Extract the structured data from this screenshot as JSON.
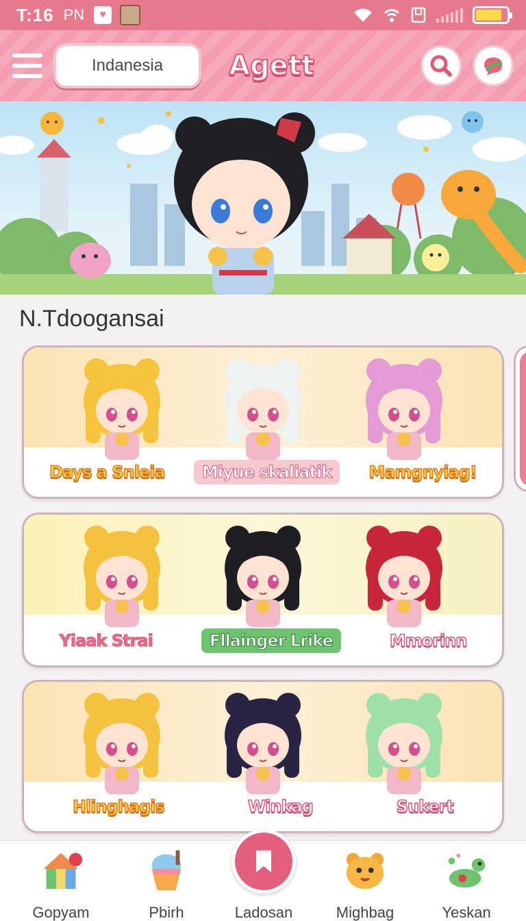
{
  "status_bar": {
    "time": "T:16",
    "ampm": "PN",
    "battery_level": 0.85
  },
  "header": {
    "region": "Indanesia",
    "title": "Agett"
  },
  "section": {
    "title": "N.Tdoogansai"
  },
  "cards": [
    {
      "characters": [
        {
          "name": "Days a Snleia",
          "hair": "#f7c33a"
        },
        {
          "name": "Miyue skaliatik",
          "hair": "#eef2f2"
        },
        {
          "name": "Mamgnyiag!",
          "hair": "#e49ad2"
        }
      ]
    },
    {
      "characters": [
        {
          "name": "Yiaak Strai",
          "hair": "#f5c13e"
        },
        {
          "name": "Fllainger Lrike",
          "hair": "#1e1e24"
        },
        {
          "name": "Mmorinn",
          "hair": "#c8263a"
        }
      ]
    },
    {
      "characters": [
        {
          "name": "Hlinghagis",
          "hair": "#f5c13e"
        },
        {
          "name": "Winkag",
          "hair": "#2a2444"
        },
        {
          "name": "Sukert",
          "hair": "#9fe0a8"
        }
      ]
    }
  ],
  "bottom_nav": [
    {
      "label": "Gopyam",
      "icon": "house-icon"
    },
    {
      "label": "Pbirh",
      "icon": "shaved-ice-icon"
    },
    {
      "label": "Ladosan",
      "icon": "bookmark-icon"
    },
    {
      "label": "Mighbag",
      "icon": "bear-icon"
    },
    {
      "label": "Yeskan",
      "icon": "dinosaur-icon"
    }
  ],
  "colors": {
    "brand_pink": "#e8798c",
    "header_pink": "#f49db0",
    "fab": "#e35f7c"
  }
}
